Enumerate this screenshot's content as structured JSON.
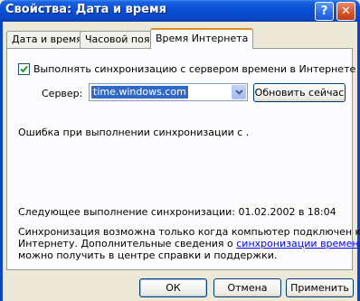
{
  "window": {
    "title": "Свойства: Дата и время",
    "help_glyph": "?",
    "close_glyph": "✕"
  },
  "tabs": [
    {
      "label": "Дата и время",
      "active": false
    },
    {
      "label": "Часовой пояс",
      "active": false
    },
    {
      "label": "Время Интернета",
      "active": true
    }
  ],
  "sync": {
    "checkbox_label": "Выполнять синхронизацию с сервером времени в Интернете",
    "checked": true,
    "server_label": "Сервер:",
    "server_value": "time.windows.com",
    "update_button": "Обновить сейчас",
    "error_text": "Ошибка при выполнении синхронизации с .",
    "next_sync_text": "Следующее выполнение синхронизации: 01.02.2002 в 18:04",
    "info_line1": "Синхронизация возможна только когда компьютер подключен к",
    "info_line2_prefix": "Интернету. Дополнительные сведения о ",
    "info_link": "синхронизации времени",
    "info_line3": "можно получить в центре справки и поддержки."
  },
  "footer": {
    "ok": "ОК",
    "cancel": "Отмена",
    "apply": "Применить"
  },
  "colors": {
    "titlebar": "#0a4fd6",
    "dialog_bg": "#ece9d8",
    "active_tab_accent": "#e68b2c",
    "selection": "#316ac5",
    "link": "#0000ff"
  }
}
